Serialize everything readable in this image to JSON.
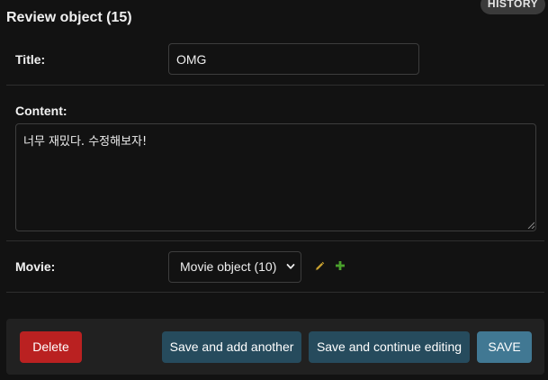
{
  "header": {
    "title": "Review object (15)",
    "history_label": "HISTORY"
  },
  "form": {
    "title_field": {
      "label": "Title:",
      "value": "OMG"
    },
    "content_field": {
      "label": "Content:",
      "value": "너무 재밌다. 수정해보자!"
    },
    "movie_field": {
      "label": "Movie:",
      "selected": "Movie object (10)"
    }
  },
  "icons": {
    "edit": "pencil-icon",
    "add": "plus-icon",
    "edit_color": "#c8a030",
    "add_color": "#4aa02c"
  },
  "actions": {
    "delete_label": "Delete",
    "save_add_another_label": "Save and add another",
    "save_continue_label": "Save and continue editing",
    "save_label": "SAVE"
  },
  "colors": {
    "background": "#121212",
    "delete": "#ba2121",
    "secondary_button": "#264b5d",
    "primary_button": "#417893"
  }
}
